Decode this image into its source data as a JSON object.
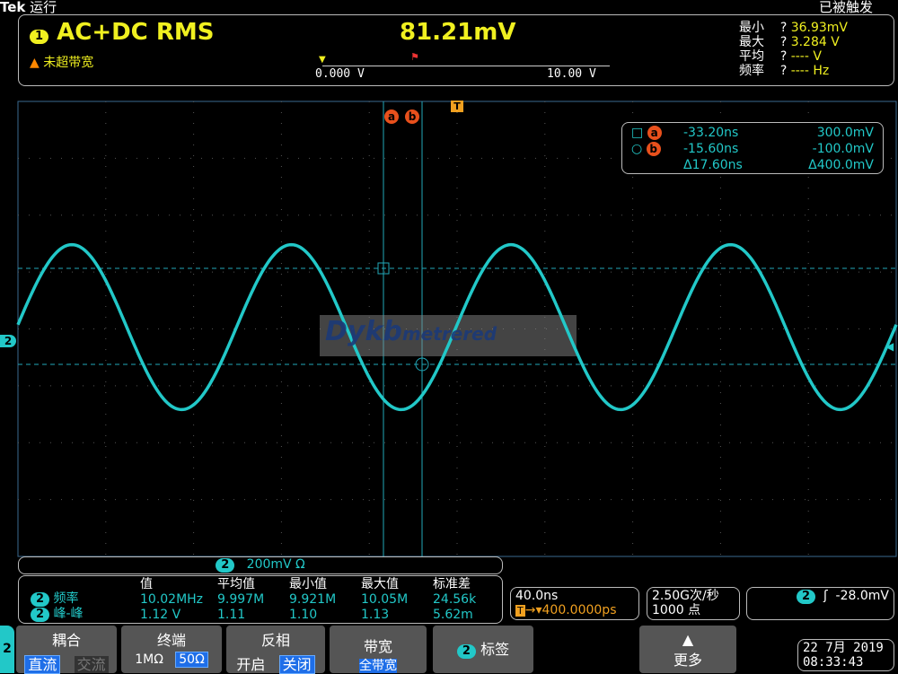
{
  "header": {
    "brand": "Tek",
    "run_state": "运行",
    "trigger_state": "已被触发"
  },
  "meas_panel": {
    "channel": "1",
    "measurement": "AC+DC RMS",
    "value": "81.21mV",
    "warning": "未超带宽",
    "scale_min": "0.000 V",
    "scale_max": "10.00 V",
    "stats": [
      {
        "label": "最小",
        "q": "?",
        "value": "36.93mV"
      },
      {
        "label": "最大",
        "q": "?",
        "value": "3.284 V"
      },
      {
        "label": "平均",
        "q": "?",
        "value": "---- V"
      },
      {
        "label": "频率",
        "q": "?",
        "value": "---- Hz"
      }
    ]
  },
  "cursors": {
    "a_label": "a",
    "b_label": "b",
    "trigger_marker": "T",
    "a_time": "-33.20ns",
    "a_volt": "300.0mV",
    "b_time": "-15.60ns",
    "b_volt": "-100.0mV",
    "d_time": "Δ17.60ns",
    "d_volt": "Δ400.0mV"
  },
  "watermark": {
    "text1": "Dykb",
    "text2": "metrered"
  },
  "channel": {
    "num": "2",
    "scale": "200mV Ω"
  },
  "waveform": {
    "color": "#22c8c8",
    "cycles_visible": 4.0,
    "amplitude_div": 1.45
  },
  "meas_table": {
    "headers": [
      "值",
      "平均值",
      "最小值",
      "最大值",
      "标准差"
    ],
    "rows": [
      {
        "ch": "2",
        "name": "频率",
        "vals": [
          "10.02MHz",
          "9.997M",
          "9.921M",
          "10.05M",
          "24.56k"
        ]
      },
      {
        "ch": "2",
        "name": "峰-峰",
        "vals": [
          "1.12 V",
          "1.11",
          "1.10",
          "1.13",
          "5.62m"
        ]
      }
    ]
  },
  "timebase": {
    "scale": "40.0ns",
    "position": "400.0000ps",
    "t": "T"
  },
  "acq": {
    "rate": "2.50G次/秒",
    "points": "1000 点"
  },
  "trigger": {
    "ch": "2",
    "level": "-28.0mV"
  },
  "menu": {
    "side": "2",
    "coupling": {
      "title": "耦合",
      "a": "直流",
      "b": "交流"
    },
    "termination": {
      "title": "终端",
      "a": "1MΩ",
      "b": "50Ω"
    },
    "invert": {
      "title": "反相",
      "a": "开启",
      "b": "关闭"
    },
    "bandwidth": {
      "title": "带宽",
      "value": "全带宽"
    },
    "label": {
      "ch": "2",
      "title": "标签"
    },
    "more": "更多"
  },
  "datetime": {
    "date": "22 7月  2019",
    "time": "08:33:43"
  }
}
